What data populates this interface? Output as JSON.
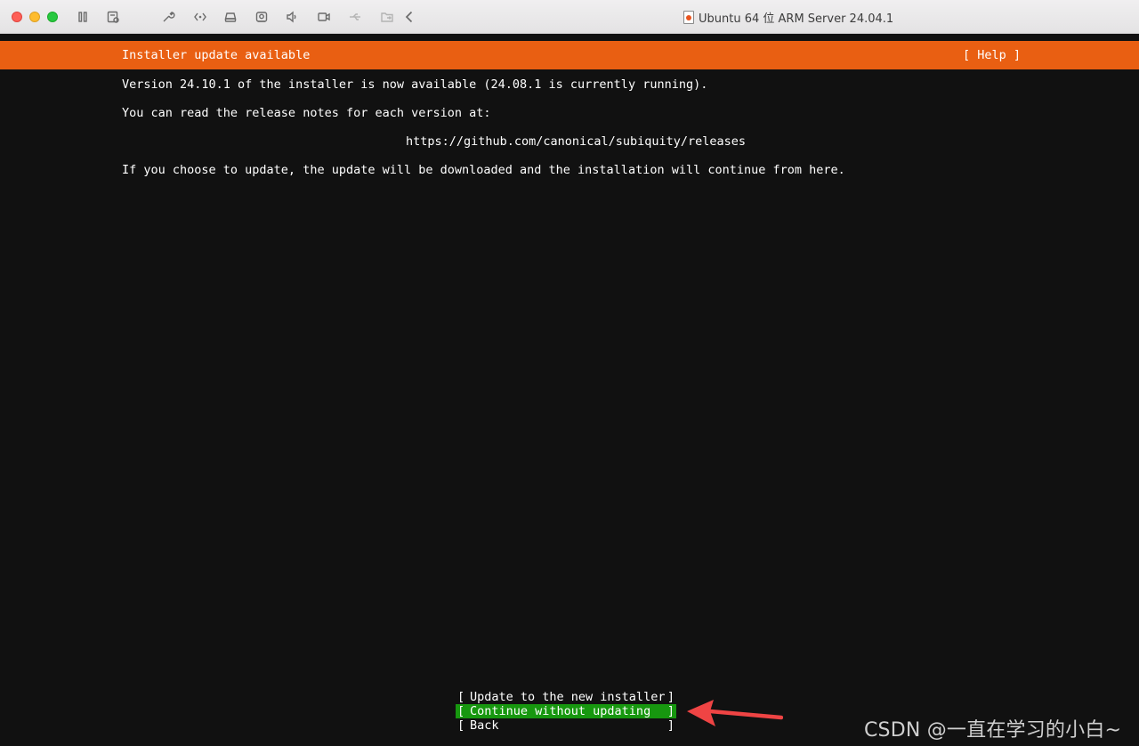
{
  "window": {
    "title": "Ubuntu 64 位 ARM Server 24.04.1",
    "toolbar_icons": [
      "pause-icon",
      "snapshot-icon",
      "wrench-icon",
      "network-icon",
      "disk-icon",
      "camera-icon",
      "sound-icon",
      "video-icon",
      "usb-icon",
      "shared-folder-icon",
      "chevron-left-icon"
    ]
  },
  "installer": {
    "header_title": "Installer update available",
    "help_label": "[ Help ]",
    "lines": {
      "version": "Version 24.10.1 of the installer is now available (24.08.1 is currently running).",
      "release_notes": "You can read the release notes for each version at:",
      "url": "https://github.com/canonical/subiquity/releases",
      "update_note": "If you choose to update, the update will be downloaded and the installation will continue from here."
    },
    "buttons": [
      {
        "label": "Update to the new installer",
        "focused": false
      },
      {
        "label": "Continue without updating",
        "focused": true
      },
      {
        "label": "Back",
        "focused": false
      }
    ]
  },
  "colors": {
    "header_orange": "#e95f12",
    "focus_green": "#17970f",
    "terminal_bg": "#111111",
    "arrow_red": "#ef4444"
  },
  "watermark": "CSDN @一直在学习的小白~"
}
